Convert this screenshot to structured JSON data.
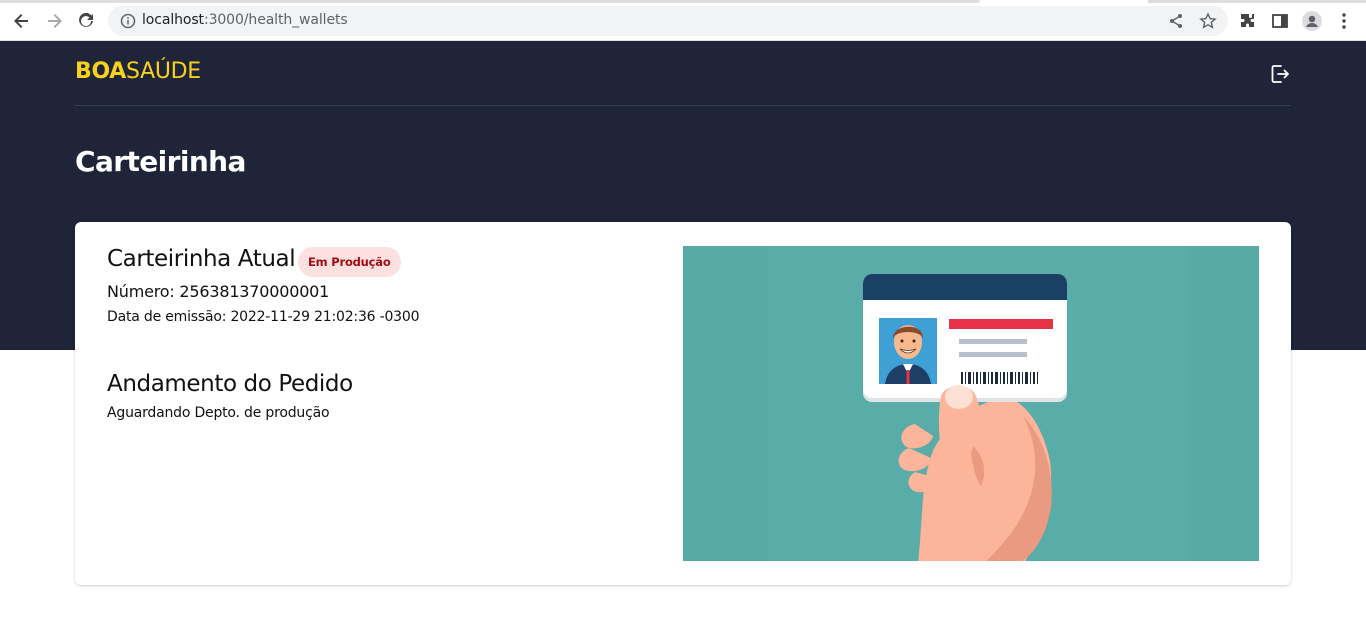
{
  "browser": {
    "url_host": "localhost",
    "url_path": ":3000/health_wallets"
  },
  "header": {
    "logo_strong": "BOA",
    "logo_light": "SAÚDE",
    "page_title": "Carteirinha"
  },
  "card": {
    "title": "Carteirinha Atual",
    "status_badge": "Em Produção",
    "number": "Número: 256381370000001",
    "issue_date": "Data de emissão: 2022-11-29 21:02:36 -0300",
    "order_title": "Andamento do Pedido",
    "order_status": "Aguardando Depto. de produção"
  },
  "colors": {
    "header_bg": "#1f2438",
    "brand_yellow": "#f7d11c",
    "badge_bg": "#fde0e0",
    "badge_text": "#a10d14",
    "illustration_bg": "#58aba5"
  }
}
